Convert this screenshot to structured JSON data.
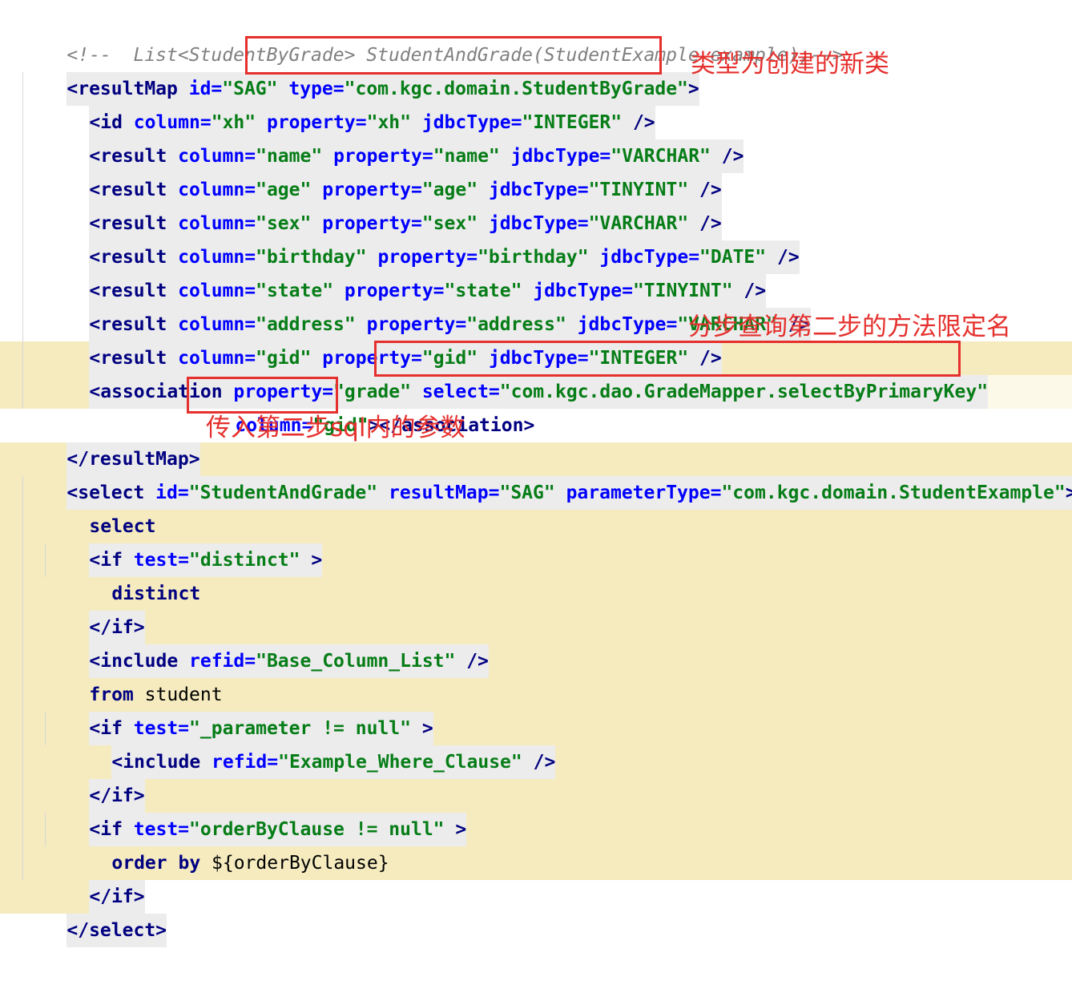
{
  "comment": "<!--  List<StudentByGrade> StudentAndGrade(StudentExample example);-->",
  "code": {
    "l1": {
      "open": "<resultMap ",
      "a1": "id=",
      "v1": "\"SAG\"",
      "a2": "type=",
      "v2": "\"com.kgc.domain.StudentByGrade\"",
      "close": ">"
    },
    "l2": {
      "open": "<id ",
      "a1": "column=",
      "v1": "\"xh\"",
      "a2": "property=",
      "v2": "\"xh\"",
      "a3": "jdbcType=",
      "v3": "\"INTEGER\"",
      "close": " />"
    },
    "l3": {
      "open": "<result ",
      "a1": "column=",
      "v1": "\"name\"",
      "a2": "property=",
      "v2": "\"name\"",
      "a3": "jdbcType=",
      "v3": "\"VARCHAR\"",
      "close": " />"
    },
    "l4": {
      "open": "<result ",
      "a1": "column=",
      "v1": "\"age\"",
      "a2": "property=",
      "v2": "\"age\"",
      "a3": "jdbcType=",
      "v3": "\"TINYINT\"",
      "close": " />"
    },
    "l5": {
      "open": "<result ",
      "a1": "column=",
      "v1": "\"sex\"",
      "a2": "property=",
      "v2": "\"sex\"",
      "a3": "jdbcType=",
      "v3": "\"VARCHAR\"",
      "close": " />"
    },
    "l6": {
      "open": "<result ",
      "a1": "column=",
      "v1": "\"birthday\"",
      "a2": "property=",
      "v2": "\"birthday\"",
      "a3": "jdbcType=",
      "v3": "\"DATE\"",
      "close": " />"
    },
    "l7": {
      "open": "<result ",
      "a1": "column=",
      "v1": "\"state\"",
      "a2": "property=",
      "v2": "\"state\"",
      "a3": "jdbcType=",
      "v3": "\"TINYINT\"",
      "close": " />"
    },
    "l8": {
      "open": "<result ",
      "a1": "column=",
      "v1": "\"address\"",
      "a2": "property=",
      "v2": "\"address\"",
      "a3": "jdbcType=",
      "v3": "\"VARCHAR\"",
      "close": " />"
    },
    "l9": {
      "open": "<result ",
      "a1": "column=",
      "v1": "\"gid\"",
      "a2": "property=",
      "v2": "\"gid\"",
      "a3": "jdbcType=",
      "v3": "\"INTEGER\"",
      "close": " />"
    },
    "l10": {
      "open": "<association ",
      "a1": "property=",
      "v1": "\"grade\"",
      "a2": "select=",
      "v2": "\"com.kgc.dao.GradeMapper.selectByPrimaryKey\""
    },
    "l11": {
      "a1": "column=",
      "v1": "\"gid\"",
      "close": "></association>"
    },
    "l12": {
      "close": "</resultMap>"
    },
    "l13": {
      "open": "<select ",
      "a1": "id=",
      "v1": "\"StudentAndGrade\"",
      "a2": "resultMap=",
      "v2": "\"SAG\"",
      "a3": "parameterType=",
      "v3": "\"com.kgc.domain.StudentExample\"",
      "close": ">"
    },
    "l14": {
      "text": "select"
    },
    "l15": {
      "open": "<if ",
      "a1": "test=",
      "v1": "\"distinct\"",
      "close": " >"
    },
    "l16": {
      "text": "distinct"
    },
    "l17": {
      "close": "</if>"
    },
    "l18": {
      "open": "<include ",
      "a1": "refid=",
      "v1": "\"Base_Column_List\"",
      "close": " />"
    },
    "l19": {
      "kw": "from",
      "text": " student"
    },
    "l20": {
      "open": "<if ",
      "a1": "test=",
      "v1": "\"_parameter != null\"",
      "close": " >"
    },
    "l21": {
      "open": "<include ",
      "a1": "refid=",
      "v1": "\"Example_Where_Clause\"",
      "close": " />"
    },
    "l22": {
      "close": "</if>"
    },
    "l23": {
      "open": "<if ",
      "a1": "test=",
      "v1": "\"orderByClause != null\"",
      "close": " >"
    },
    "l24": {
      "kw": "order by",
      "text": " ${orderByClause}"
    },
    "l25": {
      "close": "</if>"
    },
    "l26": {
      "close": "</select>"
    }
  },
  "annotations": {
    "type_note": "类型为创建的新类",
    "select_note": "分步查询第二步的方法限定名",
    "column_note": "传入第二步sql内的参数"
  },
  "colors": {
    "tag": "#000080",
    "attribute": "#0000ff",
    "string": "#067d17",
    "comment": "#808080",
    "highlight": "#f5ebbf",
    "annotation": "#e5302d"
  }
}
